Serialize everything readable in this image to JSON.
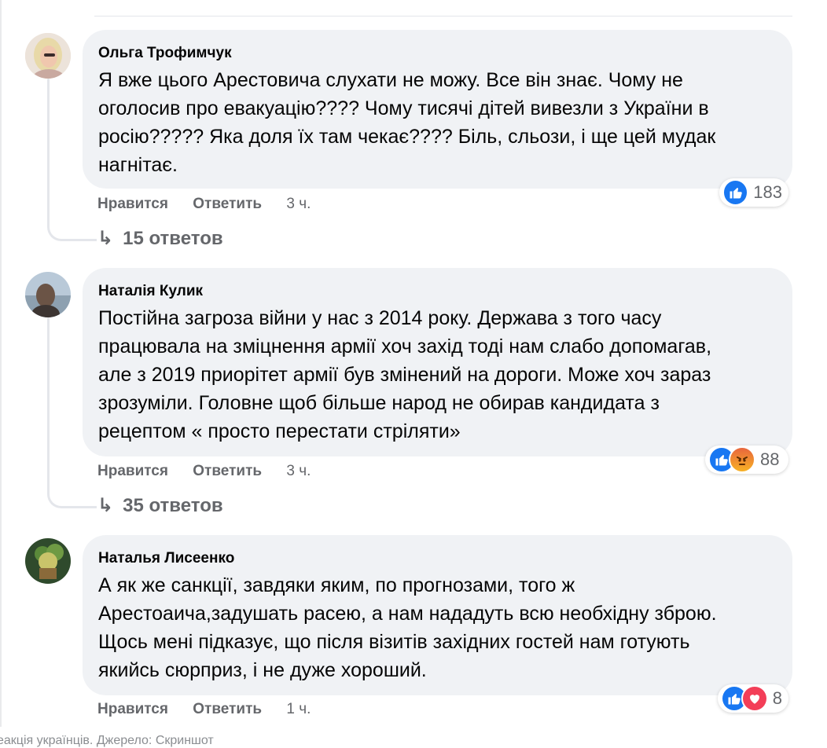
{
  "comments": [
    {
      "author": "Ольга Трофимчук",
      "text": "Я вже цього Арестовича слухати не можу. Все він знає. Чому не\nоголосив про евакуацію???? Чому тисячі дітей вивезли з України в\nросію????? Яка доля їх там чекає???? Біль, сльози, і ще цей мудак\nнагнітає.",
      "like_label": "Нравится",
      "reply_label": "Ответить",
      "time": "3 ч.",
      "reactions": [
        "like-icon"
      ],
      "reaction_count": "183",
      "replies": "15 ответов"
    },
    {
      "author": "Наталія Кулик",
      "text": "Постійна загроза війни у нас з 2014 року. Держава з того часу\nпрацювала на зміцнення армії хоч захід тоді нам слабо допомагав,\nале з 2019 приорітет армії був змінений на дороги. Може хоч зараз\nзрозуміли. Головне щоб більше народ не обирав кандидата з\nрецептом « просто перестати стріляти»",
      "like_label": "Нравится",
      "reply_label": "Ответить",
      "time": "3 ч.",
      "reactions": [
        "like-icon",
        "angry-icon"
      ],
      "reaction_count": "88",
      "replies": "35 ответов"
    },
    {
      "author": "Наталья Лисеенко",
      "text": "А як же санкції, завдяки яким, по прогнозами, того ж\nАрестоаича,задушать расею, а нам нададуть всю необхідну зброю.\nЩось мені підказує, що після візитів західних гостей нам готують\nякийсь сюрприз, і не дуже хороший.",
      "like_label": "Нравится",
      "reply_label": "Ответить",
      "time": "1 ч.",
      "reactions": [
        "like-icon",
        "love-icon"
      ],
      "reaction_count": "8"
    }
  ],
  "caption": "еакція українців. Джерело: Скриншот"
}
